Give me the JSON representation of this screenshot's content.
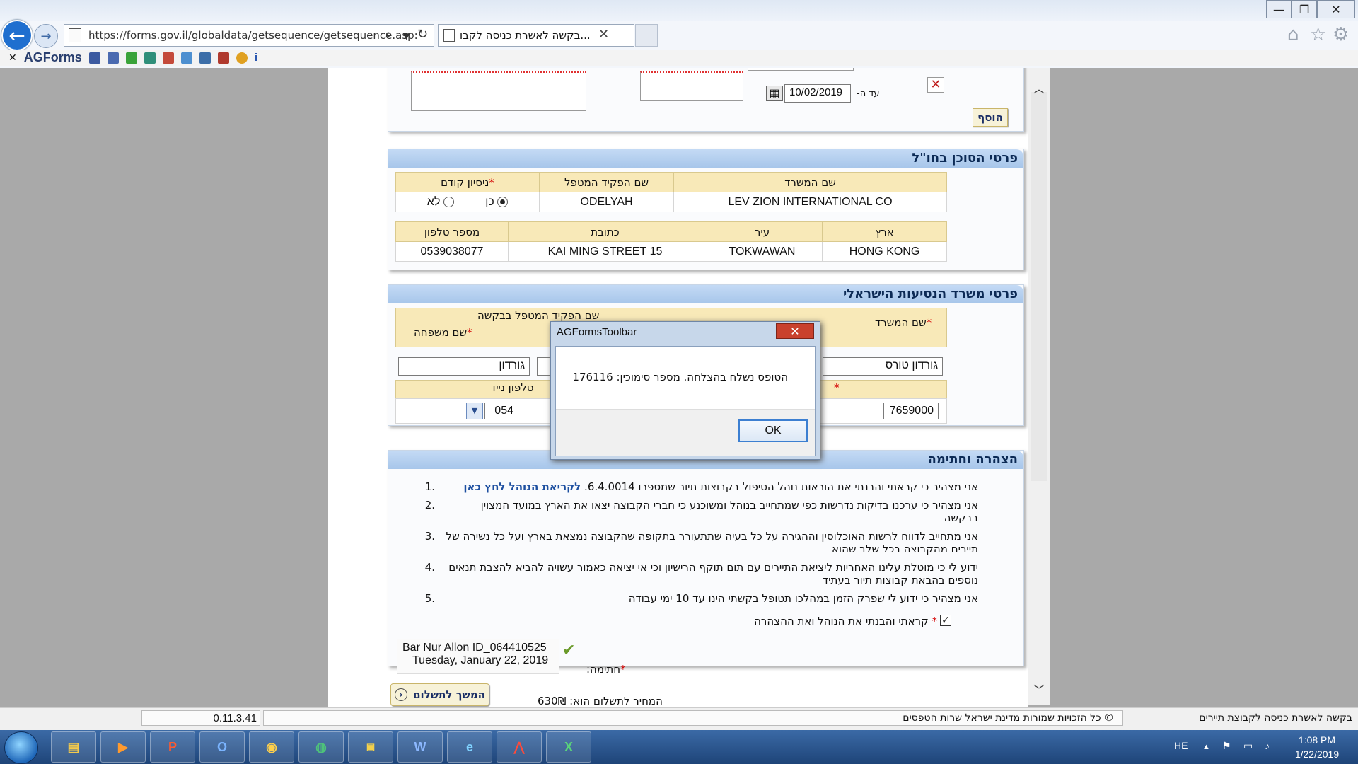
{
  "browser": {
    "url": "https://forms.gov.il/globaldata/getsequence/getsequence.asp:",
    "tab_title": "בקשה לאשרת כניסה לקבו...",
    "toolbar_brand": "AGForms"
  },
  "page": {
    "top_section": {
      "until_label": "עד ה-",
      "until_date": "10/02/2019",
      "add_button": "הוסף"
    },
    "agent_abroad": {
      "title": "פרטי הסוכן בחו\"ל",
      "headers": [
        "שם המשרד",
        "שם הפקיד המטפל",
        "ניסיון קודם"
      ],
      "office": "LEV ZION INTERNATIONAL CO",
      "clerk": "ODELYAH",
      "yes_label": "כן",
      "no_label": "לא",
      "headers2": [
        "ארץ",
        "עיר",
        "כתובת",
        "מספר טלפון"
      ],
      "country": "HONG KONG",
      "city": "TOKWAWAN",
      "address": "15 KAI MING STREET",
      "phone": "0539038077"
    },
    "israeli_office": {
      "title": "פרטי משרד הנסיעות הישראלי",
      "office_label": "שם המשרד",
      "clerk_group_label": "שם הפקיד המטפל בבקשה",
      "lastname_label": "שם משפחה",
      "office_value": "גורדון טורס",
      "lastname_value": "גורדון",
      "mobile_label": "טלפון נייד",
      "mobile_prefix": "054",
      "phone_value": "7659000"
    },
    "declaration": {
      "title": "הצהרה וחתימה",
      "items": [
        {
          "n": "1.",
          "text": "אני מצהיר כי קראתי והבנתי את הוראות נוהל הטיפול בקבוצות תיור שמספרו 6.4.0014.",
          "link": "לקריאת הנוהל לחץ כאן"
        },
        {
          "n": "2.",
          "text": "אני מצהיר כי ערכנו בדיקות נדרשות כפי שמתחייב בנוהל ומשוכנע כי חברי הקבוצה יצאו את הארץ במועד המצוין בבקשה",
          "link": ""
        },
        {
          "n": "3.",
          "text": "אני מתחייב לדווח לרשות האוכלוסין וההגירה על כל בעיה שתתעורר בתקופה שהקבוצה נמצאת בארץ ועל כל נשירה של תיירים מהקבוצה בכל שלב שהוא",
          "link": ""
        },
        {
          "n": "4.",
          "text": "ידוע לי כי מוטלת עלינו האחריות ליציאת התיירים עם תום תוקף הרישיון וכי אי יציאה כאמור עשויה להביא להצבת תנאים נוספים בהבאת קבוצות תיור בעתיד",
          "link": ""
        },
        {
          "n": "5.",
          "text": "אני מצהיר כי ידוע לי שפרק הזמן במהלכו תטופל בקשתי הינו עד 10 ימי עבודה",
          "link": ""
        }
      ],
      "agree_label": "קראתי והבנתי את הנוהל ואת ההצהרה",
      "signature_label": "חתימה:",
      "signer": "Bar Nur Allon ID_064410525",
      "sign_date": "Tuesday, January 22, 2019"
    },
    "continue_button": "המשך לתשלום",
    "price_text": "המחיר לתשלום הוא: 630₪"
  },
  "dialog": {
    "title": "AGFormsToolbar",
    "message": "הטופס נשלח בהצלחה. מספר סימוכין: 176116",
    "ok": "OK"
  },
  "statusbar": {
    "version": "0.11.3.41",
    "copyright": "© כל הזכויות שמורות מדינת ישראל שרות הטפסים",
    "title": "בקשה לאשרת כניסה לקבוצת תיירים"
  },
  "taskbar": {
    "lang": "HE",
    "time": "1:08 PM",
    "date": "1/22/2019",
    "apps": [
      "explorer",
      "media",
      "powerpoint",
      "outlook",
      "chrome",
      "globe",
      "files",
      "word",
      "ie",
      "acrobat",
      "excel"
    ]
  }
}
